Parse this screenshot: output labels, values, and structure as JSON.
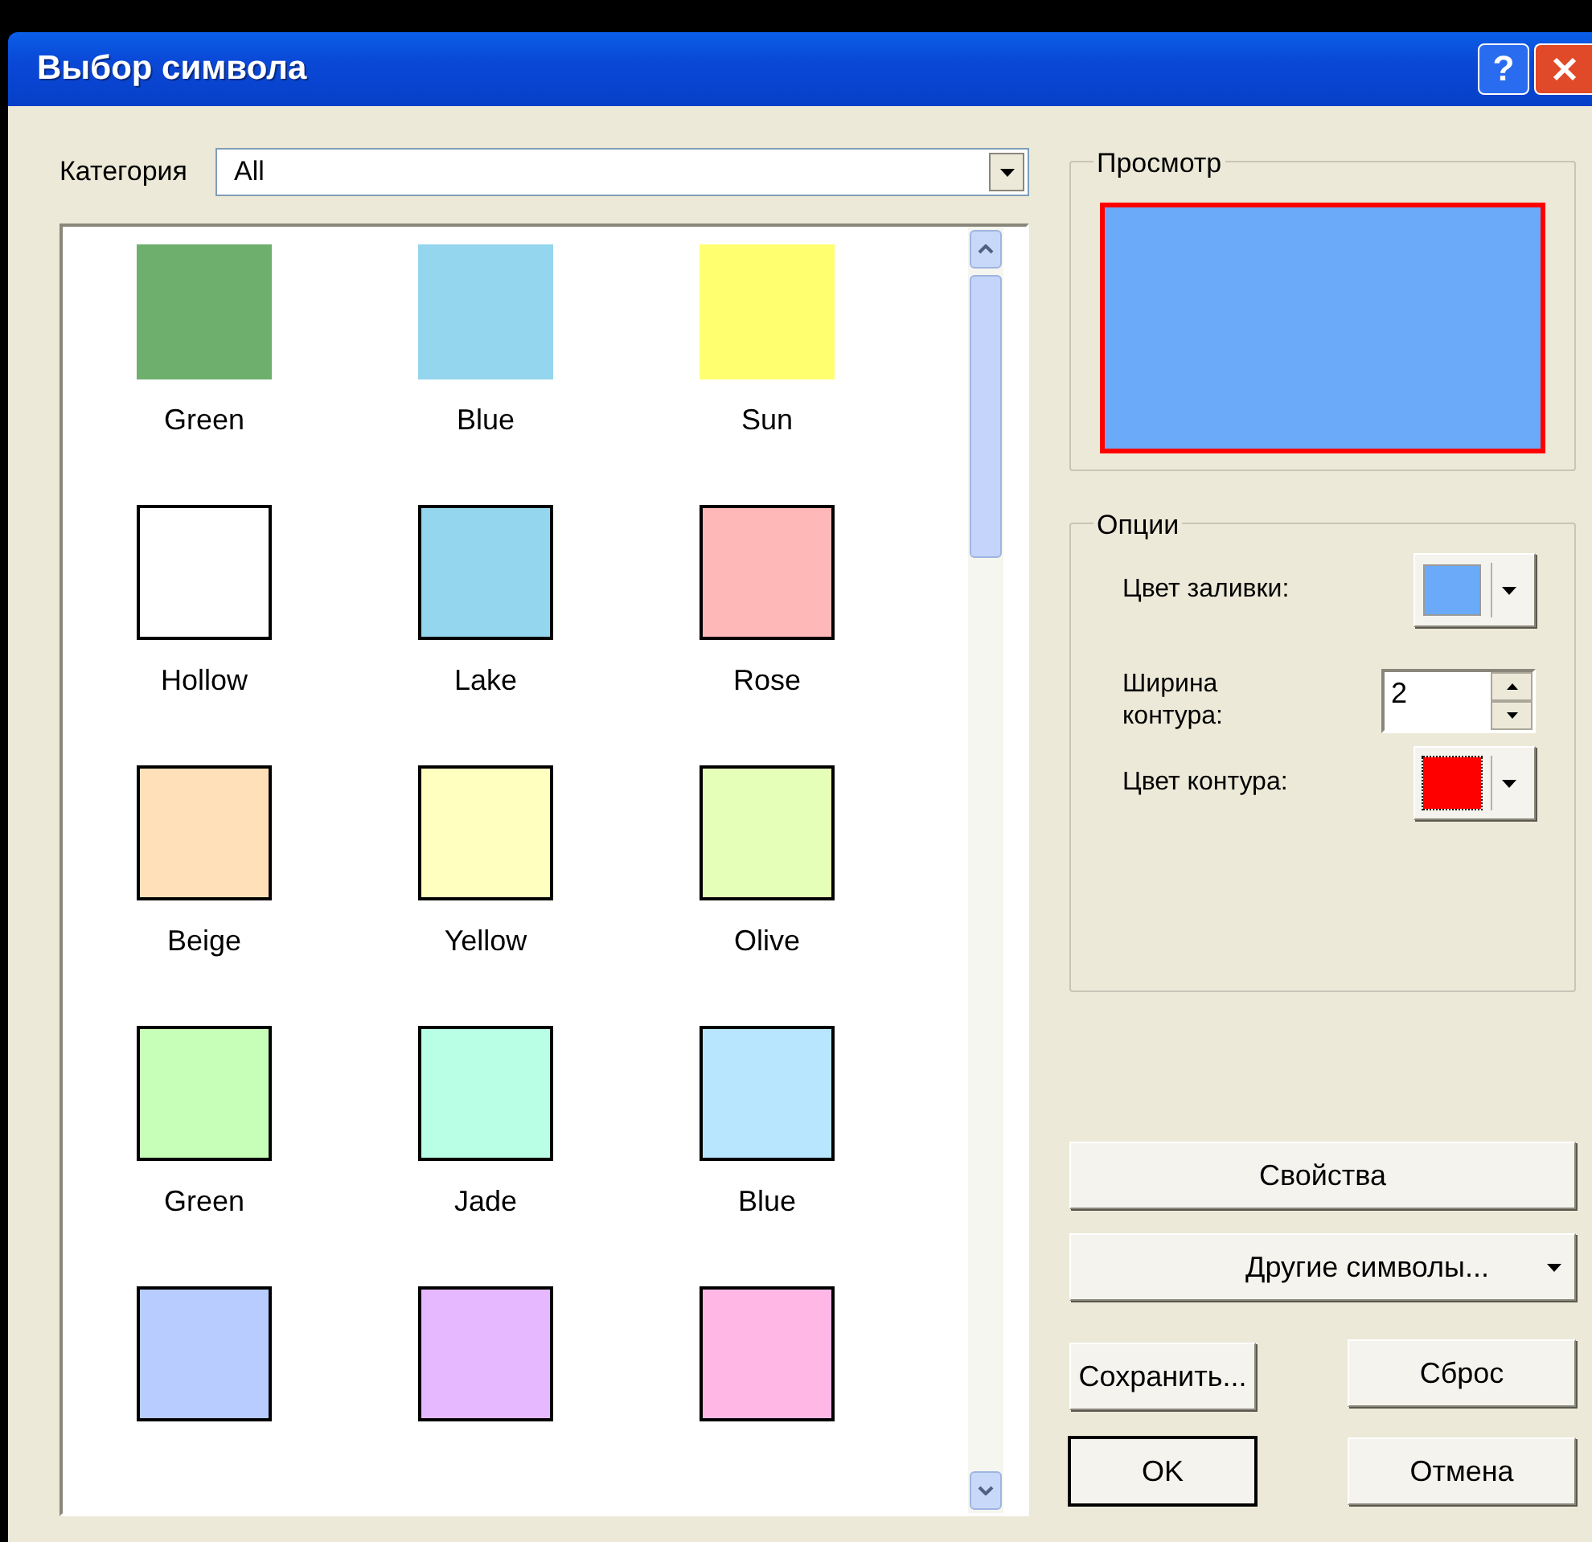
{
  "window": {
    "title": "Выбор символа",
    "help_button": "?"
  },
  "category": {
    "label": "Категория",
    "value": "All"
  },
  "symbols": [
    {
      "label": "Green",
      "color": "#6eaf6e",
      "outlined": false
    },
    {
      "label": "Blue",
      "color": "#94d6ee",
      "outlined": false
    },
    {
      "label": "Sun",
      "color": "#ffff70",
      "outlined": false
    },
    {
      "label": "Hollow",
      "color": "#ffffff",
      "outlined": true
    },
    {
      "label": "Lake",
      "color": "#94d6ee",
      "outlined": true
    },
    {
      "label": "Rose",
      "color": "#ffb8b8",
      "outlined": true
    },
    {
      "label": "Beige",
      "color": "#ffe0b8",
      "outlined": true
    },
    {
      "label": "Yellow",
      "color": "#ffffc0",
      "outlined": true
    },
    {
      "label": "Olive",
      "color": "#e6ffb8",
      "outlined": true
    },
    {
      "label": "Green",
      "color": "#c8ffb8",
      "outlined": true
    },
    {
      "label": "Jade",
      "color": "#b8ffe6",
      "outlined": true
    },
    {
      "label": "Blue",
      "color": "#b8e6ff",
      "outlined": true
    },
    {
      "color": "#b8ccff",
      "outlined": true
    },
    {
      "color": "#e6b8ff",
      "outlined": true
    },
    {
      "color": "#ffb8e6",
      "outlined": true
    }
  ],
  "preview": {
    "title": "Просмотр"
  },
  "options": {
    "title": "Опции",
    "fill_color": {
      "label": "Цвет заливки:",
      "color": "#6aaaf8"
    },
    "outline_width": {
      "label": "Ширина контура:",
      "value": "2"
    },
    "outline_color": {
      "label": "Цвет контура:",
      "color": "#ff0000"
    }
  },
  "buttons": {
    "properties": "Свойства",
    "more_symbols": "Другие символы...",
    "save": "Сохранить...",
    "reset": "Сброс",
    "ok": "OK",
    "cancel": "Отмена"
  }
}
